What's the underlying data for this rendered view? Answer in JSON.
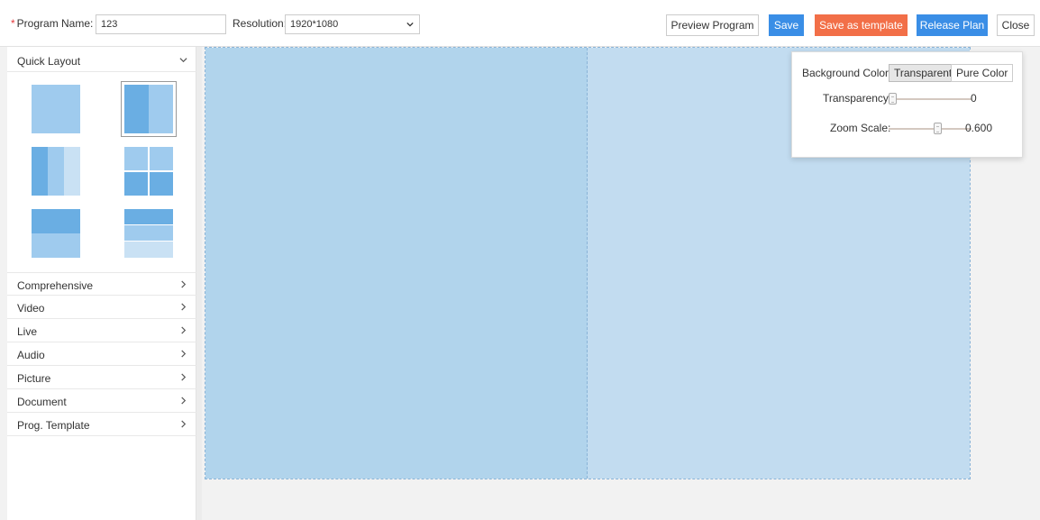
{
  "toolbar": {
    "program_name_required": "*",
    "program_name_label": "Program Name:",
    "program_name_value": "123",
    "resolution_label": "Resolution:",
    "resolution_value": "1920*1080",
    "preview_label": "Preview Program",
    "save_label": "Save",
    "save_template_label": "Save as template",
    "release_label": "Release Plan",
    "close_label": "Close"
  },
  "sidebar": {
    "quick_layout_title": "Quick Layout",
    "categories": [
      "Comprehensive",
      "Video",
      "Live",
      "Audio",
      "Picture",
      "Document",
      "Prog. Template"
    ]
  },
  "panel": {
    "bg_color_label": "Background Color:",
    "bg_options": [
      "Transparent",
      "Pure Color"
    ],
    "bg_selected": "Transparent",
    "transparency_label": "Transparency:",
    "transparency_value": "0",
    "zoom_label": "Zoom Scale:",
    "zoom_value": "0.600"
  },
  "colors": {
    "primary": "#3a8ee6",
    "orange": "#f26f48",
    "region_left": "#b1d4ec",
    "region_right": "#c2dcf0"
  }
}
